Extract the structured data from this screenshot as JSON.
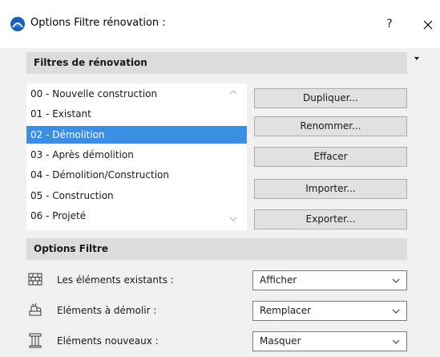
{
  "window": {
    "title": "Options Filtre rénovation :",
    "help_label": "?",
    "close_label": "✕"
  },
  "filters_section": {
    "title": "Filtres de rénovation",
    "items": [
      {
        "label": "00 - Nouvelle construction",
        "selected": false
      },
      {
        "label": "01 - Existant",
        "selected": false
      },
      {
        "label": "02 - Démolition",
        "selected": true
      },
      {
        "label": "03 - Après démolition",
        "selected": false
      },
      {
        "label": "04 - Démolition/Construction",
        "selected": false
      },
      {
        "label": "05 - Construction",
        "selected": false
      },
      {
        "label": "06 - Projeté",
        "selected": false
      }
    ],
    "buttons": {
      "duplicate": "Dupliquer...",
      "rename": "Renommer...",
      "delete": "Effacer",
      "import": "Importer...",
      "export": "Exporter..."
    }
  },
  "options_section": {
    "title": "Options Filtre",
    "rows": [
      {
        "label": "Les éléments existants :",
        "value": "Afficher",
        "icon": "existing-elements-icon"
      },
      {
        "label": "Eléments à démolir :",
        "value": "Remplacer",
        "icon": "demolish-elements-icon"
      },
      {
        "label": "Eléments nouveaux :",
        "value": "Masquer",
        "icon": "new-elements-icon"
      }
    ]
  },
  "colors": {
    "selection": "#3a8fe5",
    "section_header": "#dcdcdc",
    "dialog_background": "#f0f0f0"
  }
}
